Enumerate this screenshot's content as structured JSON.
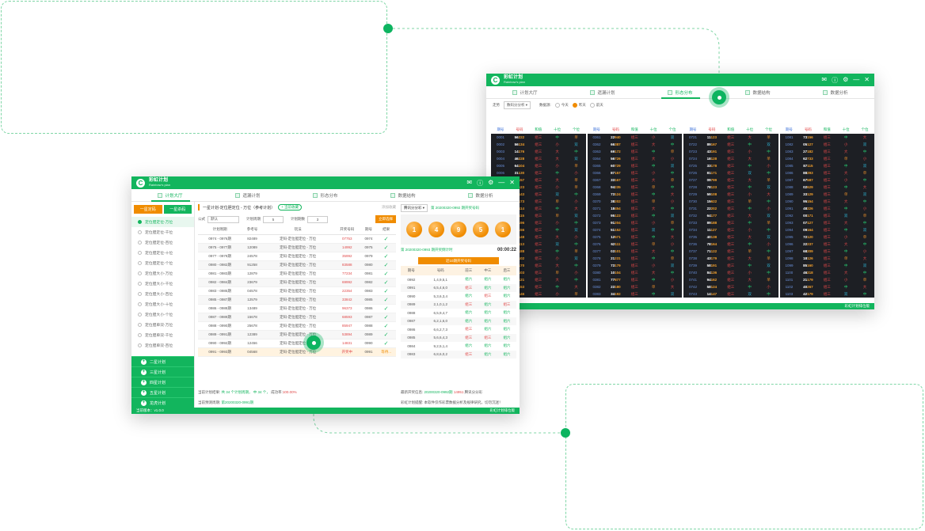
{
  "colors": {
    "brand": "#12b55d",
    "accent": "#f08c00",
    "dark_grid": "#1d1f24",
    "callout_border": "#7fd6a6"
  },
  "app": {
    "name_cn": "彩虹计划",
    "name_en": "Rainbow's plan",
    "controls": [
      "mail-icon",
      "info-icon",
      "settings-icon",
      "minimize-icon",
      "close-icon"
    ]
  },
  "tabs": [
    "计划大厅",
    "遗漏计划",
    "形态分布",
    "数据结构",
    "数据分析"
  ],
  "back": {
    "filter_label": "走势",
    "filter_value": "数码分分析",
    "range_label": "数据源:",
    "options": [
      "今天",
      "昨天",
      "前天"
    ],
    "active_option": 1,
    "grid_header": [
      "期号",
      "号码",
      "和值",
      "十位",
      "个位"
    ],
    "panels": [
      [
        [
          "0001",
          "56",
          "222",
          "中",
          "单"
        ],
        [
          "0002",
          "56",
          "134",
          "小",
          "双"
        ],
        [
          "0003",
          "14",
          "176",
          "大",
          "中"
        ],
        [
          "0004",
          "46",
          "228",
          "大",
          "双"
        ],
        [
          "0005",
          "64",
          "104",
          "小",
          "单"
        ],
        [
          "0006",
          "31",
          "130",
          "中",
          "小"
        ],
        [
          "0007",
          "52",
          "157",
          "大",
          "单"
        ],
        [
          "0008",
          "09",
          "123",
          "小",
          "单"
        ],
        [
          "0009",
          "90",
          "143",
          "双",
          "中"
        ],
        [
          "0010",
          "03",
          "173",
          "单",
          "小"
        ],
        [
          "0011",
          "06",
          "114",
          "中",
          "大"
        ],
        [
          "0012",
          "67",
          "115",
          "单",
          "双"
        ],
        [
          "0013",
          "39",
          "196",
          "小",
          "中"
        ],
        [
          "0014",
          "36",
          "156",
          "中",
          "双"
        ],
        [
          "0015",
          "28",
          "148",
          "大",
          "小"
        ],
        [
          "0016",
          "68",
          "113",
          "双",
          "中"
        ],
        [
          "0017",
          "24",
          "188",
          "中",
          "单"
        ],
        [
          "0018",
          "75",
          "102",
          "小",
          "双"
        ],
        [
          "0019",
          "22",
          "170",
          "大",
          "中"
        ],
        [
          "0020",
          "17",
          "103",
          "单",
          "小"
        ],
        [
          "0021",
          "29",
          "121",
          "大",
          "中"
        ],
        [
          "0022",
          "90",
          "153",
          "中",
          "大"
        ],
        [
          "0023",
          "93",
          "146",
          "小",
          "单"
        ]
      ],
      [
        [
          "0361",
          "22",
          "940",
          "小",
          "双"
        ],
        [
          "0362",
          "66",
          "387",
          "大",
          "中"
        ],
        [
          "0363",
          "69",
          "172",
          "中",
          "单"
        ],
        [
          "0364",
          "56",
          "726",
          "大",
          "小"
        ],
        [
          "0365",
          "60",
          "729",
          "中",
          "双"
        ],
        [
          "0366",
          "87",
          "157",
          "小",
          "中"
        ],
        [
          "0367",
          "33",
          "167",
          "大",
          "单"
        ],
        [
          "0368",
          "94",
          "235",
          "单",
          "中"
        ],
        [
          "0369",
          "73",
          "124",
          "中",
          "大"
        ],
        [
          "0370",
          "38",
          "202",
          "单",
          "小"
        ],
        [
          "0371",
          "18",
          "454",
          "大",
          "中"
        ],
        [
          "0372",
          "95",
          "123",
          "中",
          "双"
        ],
        [
          "0373",
          "91",
          "204",
          "小",
          "单"
        ],
        [
          "0374",
          "51",
          "152",
          "双",
          "中"
        ],
        [
          "0375",
          "12",
          "571",
          "中",
          "大"
        ],
        [
          "0376",
          "62",
          "111",
          "单",
          "小"
        ],
        [
          "0377",
          "03",
          "101",
          "大",
          "中"
        ],
        [
          "0378",
          "21",
          "231",
          "中",
          "单"
        ],
        [
          "0379",
          "73",
          "179",
          "小",
          "双"
        ],
        [
          "0380",
          "10",
          "104",
          "大",
          "中"
        ],
        [
          "0381",
          "77",
          "877",
          "中",
          "小"
        ],
        [
          "0382",
          "23",
          "180",
          "单",
          "大"
        ],
        [
          "0383",
          "34",
          "192",
          "中",
          "双"
        ]
      ],
      [
        [
          "0721",
          "11",
          "123",
          "大",
          "单"
        ],
        [
          "0722",
          "89",
          "167",
          "中",
          "双"
        ],
        [
          "0723",
          "43",
          "191",
          "小",
          "中"
        ],
        [
          "0724",
          "18",
          "128",
          "大",
          "单"
        ],
        [
          "0725",
          "33",
          "178",
          "中",
          "小"
        ],
        [
          "0726",
          "81",
          "171",
          "双",
          "中"
        ],
        [
          "0727",
          "09",
          "799",
          "大",
          "单"
        ],
        [
          "0728",
          "78",
          "123",
          "中",
          "双"
        ],
        [
          "0729",
          "59",
          "108",
          "小",
          "大"
        ],
        [
          "0730",
          "15",
          "622",
          "单",
          "中"
        ],
        [
          "0731",
          "22",
          "202",
          "中",
          "小"
        ],
        [
          "0732",
          "64",
          "177",
          "大",
          "双"
        ],
        [
          "0733",
          "89",
          "188",
          "中",
          "单"
        ],
        [
          "0734",
          "11",
          "127",
          "小",
          "中"
        ],
        [
          "0735",
          "40",
          "138",
          "大",
          "双"
        ],
        [
          "0736",
          "78",
          "164",
          "中",
          "小"
        ],
        [
          "0737",
          "71",
          "122",
          "单",
          "中"
        ],
        [
          "0738",
          "43",
          "179",
          "大",
          "单"
        ],
        [
          "0739",
          "58",
          "191",
          "中",
          "双"
        ],
        [
          "0740",
          "84",
          "136",
          "小",
          "中"
        ],
        [
          "0741",
          "94",
          "162",
          "大",
          "单"
        ],
        [
          "0742",
          "58",
          "124",
          "中",
          "小"
        ],
        [
          "0743",
          "14",
          "147",
          "双",
          "中"
        ]
      ],
      [
        [
          "1081",
          "73",
          "156",
          "中",
          "大"
        ],
        [
          "1082",
          "05",
          "127",
          "小",
          "双"
        ],
        [
          "1083",
          "27",
          "182",
          "大",
          "中"
        ],
        [
          "1084",
          "62",
          "733",
          "单",
          "小"
        ],
        [
          "1085",
          "87",
          "115",
          "中",
          "双"
        ],
        [
          "1086",
          "88",
          "293",
          "大",
          "单"
        ],
        [
          "1087",
          "67",
          "587",
          "小",
          "中"
        ],
        [
          "1088",
          "02",
          "629",
          "中",
          "大"
        ],
        [
          "1089",
          "33",
          "129",
          "单",
          "双"
        ],
        [
          "1090",
          "95",
          "154",
          "大",
          "中"
        ],
        [
          "1091",
          "48",
          "226",
          "中",
          "小"
        ],
        [
          "1092",
          "00",
          "171",
          "双",
          "单"
        ],
        [
          "1093",
          "07",
          "127",
          "大",
          "中"
        ],
        [
          "1094",
          "09",
          "164",
          "中",
          "双"
        ],
        [
          "1095",
          "72",
          "120",
          "小",
          "单"
        ],
        [
          "1096",
          "22",
          "237",
          "大",
          "中"
        ],
        [
          "1097",
          "68",
          "209",
          "中",
          "小"
        ],
        [
          "1098",
          "18",
          "126",
          "单",
          "大"
        ],
        [
          "1099",
          "85",
          "160",
          "中",
          "双"
        ],
        [
          "1100",
          "46",
          "218",
          "大",
          "中"
        ],
        [
          "1101",
          "21",
          "179",
          "小",
          "单"
        ],
        [
          "1102",
          "40",
          "267",
          "中",
          "大"
        ],
        [
          "1103",
          "42",
          "179",
          "双",
          "中"
        ]
      ]
    ],
    "status_right": "彩虹计划排位版"
  },
  "front": {
    "sidebar_tabs": [
      "一星定码",
      "一星杀码"
    ],
    "sidebar_items": [
      "定位胆定位-万位",
      "定位胆定位-千位",
      "定位胆定位-百位",
      "定位胆定位-十位",
      "定位胆定位-个位",
      "定位胆大小-万位",
      "定位胆大小-千位",
      "定位胆大小-百位",
      "定位胆大小-十位",
      "定位胆大小-个位",
      "定位胆单双-万位",
      "定位胆单双-千位",
      "定位胆单双-百位"
    ],
    "sidebar_groups": [
      "二星计划",
      "三星计划",
      "四星计划",
      "五星计划",
      "龙虎计划"
    ],
    "title": "一星计划-定位胆定位 - 万位（参考计划）",
    "title_pill": "+ 当前收藏",
    "title_right": "添加收藏",
    "form": {
      "formula_label": "公式",
      "formula_value": "默认",
      "cycle_label": "计划周期",
      "cycle_value": "5",
      "count_label": "计划期数",
      "count_value": "3",
      "button": "立即选择"
    },
    "table_headers": [
      "计划周期",
      "参考号",
      "玩法",
      "开奖号码",
      "期号",
      "结果"
    ],
    "table_rows": [
      [
        "0974 - 0976期",
        "82489",
        "定码-定位胆定位 - 万位",
        "07753",
        "0974",
        "✓"
      ],
      [
        "0975 - 0977期",
        "12089",
        "定码-定位胆定位 - 万位",
        "14992",
        "0975",
        "✓"
      ],
      [
        "0977 - 0979期",
        "24578",
        "定码-定位胆定位 - 万位",
        "35992",
        "0979",
        "✓"
      ],
      [
        "0980 - 0982期",
        "91258",
        "定码-定位胆定位 - 万位",
        "83588",
        "0980",
        "✓"
      ],
      [
        "0981 - 0983期",
        "12879",
        "定码-定位胆定位 - 万位",
        "77234",
        "0981",
        "✓"
      ],
      [
        "0982 - 0984期",
        "23679",
        "定码-定位胆定位 - 万位",
        "69992",
        "0982",
        "✓"
      ],
      [
        "0983 - 0985期",
        "04578",
        "定码-定位胆定位 - 万位",
        "22354",
        "0983",
        "✓"
      ],
      [
        "0985 - 0987期",
        "12579",
        "定码-定位胆定位 - 万位",
        "33842",
        "0985",
        "✓"
      ],
      [
        "0986 - 0988期",
        "13489",
        "定码-定位胆定位 - 万位",
        "96373",
        "0986",
        "✓"
      ],
      [
        "0987 - 0989期",
        "15678",
        "定码-定位胆定位 - 万位",
        "68593",
        "0987",
        "✓"
      ],
      [
        "0988 - 0990期",
        "25678",
        "定码-定位胆定位 - 万位",
        "85947",
        "0988",
        "✓"
      ],
      [
        "0989 - 0991期",
        "12389",
        "定码-定位胆定位 - 万位",
        "53894",
        "0989",
        "✓"
      ],
      [
        "0990 - 0992期",
        "12456",
        "定码-定位胆定位 - 万位",
        "14831",
        "0990",
        "✓"
      ],
      [
        "0991 - 0993期",
        "04568",
        "定码-定位胆定位 - 万位",
        "开奖中",
        "0991",
        "等待..."
      ]
    ],
    "foot_line1": [
      "当前计划结果:",
      "共 34 个计划周期，",
      "中 34 个，",
      "成功率:",
      "100.00%"
    ],
    "foot_line2": [
      "当前预测周期:",
      "第20200320-0991期"
    ],
    "right": {
      "select_label": "腾讯分分彩",
      "issue": "第 20200320-0992 期开奖号码",
      "balls": [
        "1",
        "4",
        "9",
        "5",
        "1"
      ],
      "next_issue": "第 20200320-0993 期开奖倒计时",
      "countdown": "00:00:22",
      "banner": "近10期开奖号码",
      "headers": [
        "期号",
        "号码",
        "前三",
        "中三",
        "后三"
      ],
      "rows": [
        [
          "0992",
          "1,4,9,5,1",
          "组六",
          "组六",
          "组六"
        ],
        [
          "0991",
          "6,5,4,6,0",
          "组三",
          "组六",
          "组六"
        ],
        [
          "0990",
          "5,3,6,3,4",
          "组六",
          "组三",
          "组六"
        ],
        [
          "0989",
          "2,1,0,1,2",
          "组三",
          "组六",
          "组三"
        ],
        [
          "0988",
          "6,5,9,4,7",
          "组六",
          "组六",
          "组六"
        ],
        [
          "0987",
          "6,2,1,6,0",
          "组六",
          "组六",
          "组六"
        ],
        [
          "0986",
          "6,6,2,7,3",
          "组三",
          "组六",
          "组六"
        ],
        [
          "0985",
          "5,6,6,4,3",
          "组三",
          "组三",
          "组六"
        ],
        [
          "0984",
          "9,2,5,1,4",
          "组六",
          "组六",
          "组六"
        ],
        [
          "0983",
          "6,8,6,0,2",
          "组三",
          "组六",
          "组六"
        ]
      ],
      "foot1": [
        "最新开奖信息:",
        "20200320-0992期",
        "14951",
        "腾讯分分彩"
      ],
      "foot2": [
        "彩虹计划提醒:",
        "本软件仅作彩票数据分析及规律研究，切勿沉迷！"
      ]
    },
    "status_left": "当前版本：v1.0.0",
    "status_right": "彩虹计划排位版"
  }
}
